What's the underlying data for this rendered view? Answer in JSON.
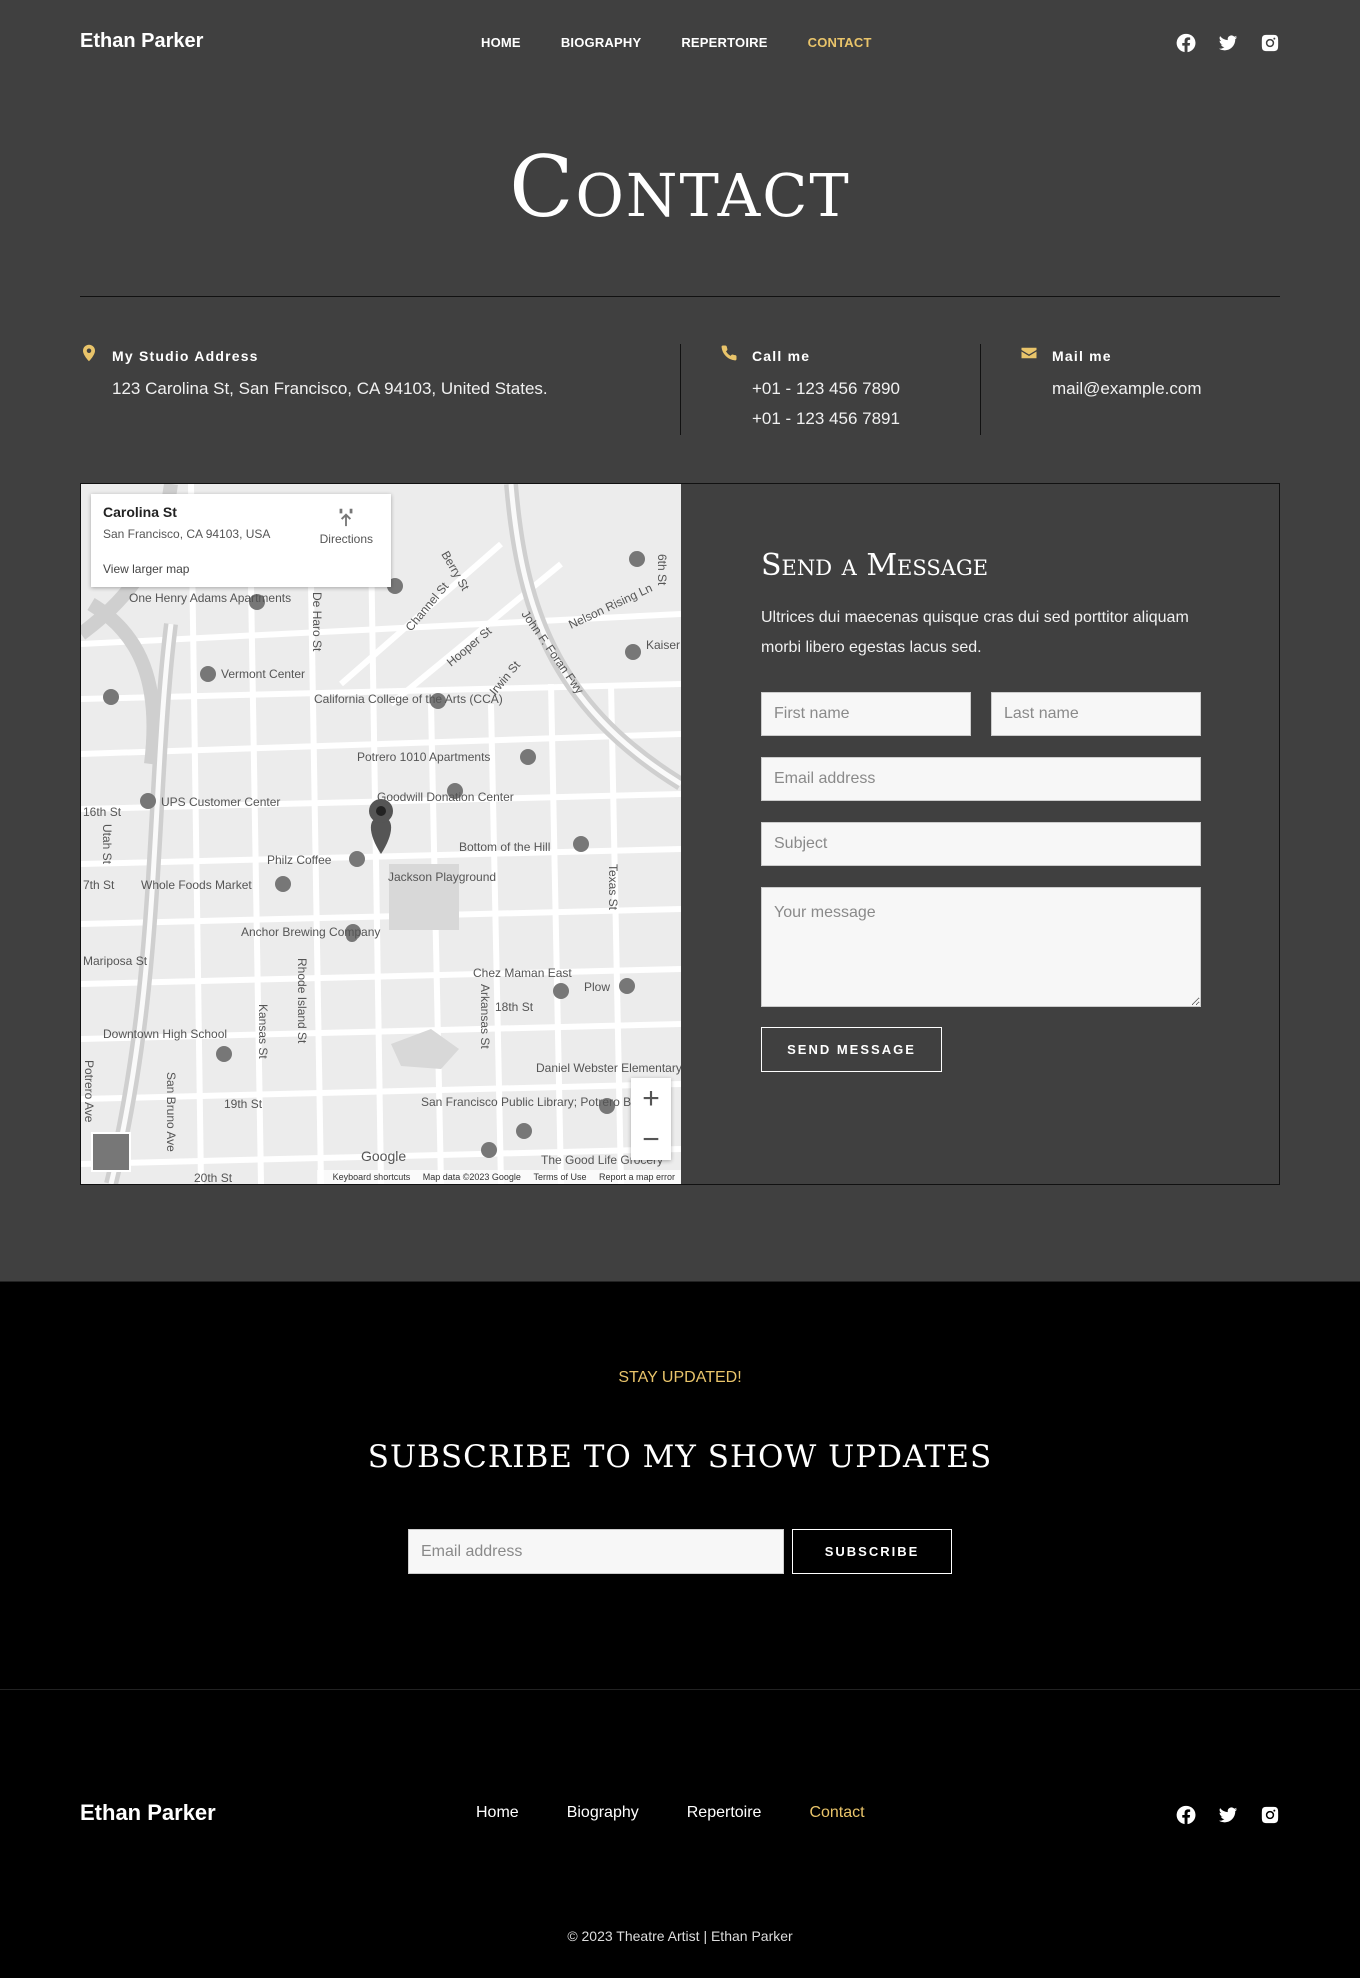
{
  "header": {
    "logo": "Ethan Parker",
    "nav": [
      "HOME",
      "BIOGRAPHY",
      "REPERTOIRE",
      "CONTACT"
    ],
    "active_nav": "CONTACT",
    "social_icons": [
      "facebook-icon",
      "twitter-icon",
      "instagram-icon"
    ]
  },
  "page_title": "Contact",
  "info": {
    "address": {
      "title": "My Studio Address",
      "line1": "123 Carolina St, San Francisco, CA 94103, United States.",
      "icon": "map-pin-icon"
    },
    "phone": {
      "title": "Call me",
      "line1": "+01 - 123 456 7890",
      "line2": "+01 - 123 456 7891",
      "icon": "phone-icon"
    },
    "mail": {
      "title": "Mail me",
      "line1": "mail@example.com",
      "icon": "envelope-icon"
    }
  },
  "map": {
    "place_name": "Carolina St",
    "place_address": "San Francisco, CA 94103, USA",
    "larger_map": "View larger map",
    "directions": "Directions",
    "labels": [
      "One Henry Adams Apartments",
      "Vermont Center",
      "California College of the Arts (CCA)",
      "Potrero 1010 Apartments",
      "Goodwill Donation Center",
      "UPS Customer Center",
      "Philz Coffee",
      "Whole Foods Market",
      "Jackson Playground",
      "Bottom of the Hill",
      "Anchor Brewing Company",
      "Chez Maman East",
      "Plow",
      "Downtown High School",
      "Daniel Webster Elementary School",
      "San Francisco Public Library; Potrero Branch",
      "The Good Life Grocery",
      "Mariposa St",
      "18th St",
      "19th St",
      "20th St",
      "7th St",
      "Berry St",
      "Channel St",
      "Hooper St",
      "Irwin St",
      "De Haro St",
      "Rhode Island St",
      "Kansas St",
      "Arkansas St",
      "Texas St",
      "Utah St",
      "San Bruno Ave",
      "Potrero Ave",
      "John F. Foran Fwy",
      "Nelson Rising Ln",
      "Kaiser San F",
      "16th St",
      "6th St"
    ],
    "zoom_in": "+",
    "zoom_out": "−",
    "google": "Google",
    "footer": [
      "Keyboard shortcuts",
      "Map data ©2023 Google",
      "Terms of Use",
      "Report a map error"
    ]
  },
  "form": {
    "title": "Send a Message",
    "description": "Ultrices dui maecenas quisque cras dui sed porttitor aliquam morbi libero egestas lacus sed.",
    "first_name_placeholder": "First name",
    "last_name_placeholder": "Last name",
    "email_placeholder": "Email address",
    "subject_placeholder": "Subject",
    "message_placeholder": "Your message",
    "submit": "SEND MESSAGE"
  },
  "subscribe": {
    "eyebrow": "STAY UPDATED!",
    "title": "SUBSCRIBE TO MY SHOW UPDATES",
    "email_placeholder": "Email address",
    "button": "SUBSCRIBE"
  },
  "footer": {
    "logo": "Ethan Parker",
    "nav": [
      "Home",
      "Biography",
      "Repertoire",
      "Contact"
    ],
    "active_nav": "Contact",
    "copyright": "© 2023 Theatre Artist | Ethan Parker"
  },
  "colors": {
    "accent": "#e9c46a",
    "bg": "#404040",
    "dark": "#000000"
  }
}
